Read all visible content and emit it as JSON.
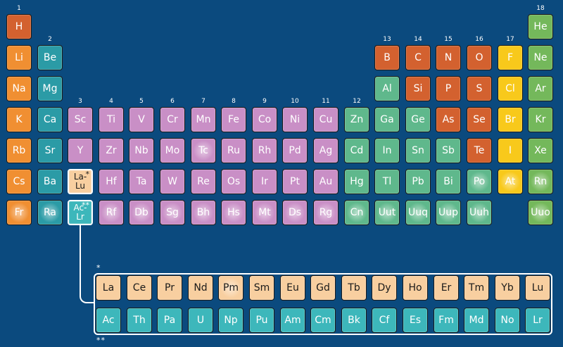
{
  "group_labels": [
    "1",
    "2",
    "3",
    "4",
    "5",
    "6",
    "7",
    "8",
    "9",
    "10",
    "11",
    "12",
    "13",
    "14",
    "15",
    "16",
    "17",
    "18"
  ],
  "colors": {
    "background": "#0b4a7e",
    "reactive_nonmetal": "#d3612f",
    "alkali_metal": "#f08f32",
    "alkaline_earth": "#2b9ba6",
    "transition_metal": "#c98fc6",
    "post_transition": "#5fb88c",
    "metalloid": "#5fb88c",
    "halogen": "#f8c91b",
    "noble_gas": "#74b85b",
    "lanthanide": "#f8cfa0",
    "actinide": "#3db7bb"
  },
  "elements": [
    {
      "sym": "H",
      "row": 1,
      "col": 1,
      "cat": "reactive_nonmetal"
    },
    {
      "sym": "He",
      "row": 1,
      "col": 18,
      "cat": "noble_gas"
    },
    {
      "sym": "Li",
      "row": 2,
      "col": 1,
      "cat": "alkali_metal"
    },
    {
      "sym": "Be",
      "row": 2,
      "col": 2,
      "cat": "alkaline_earth"
    },
    {
      "sym": "B",
      "row": 2,
      "col": 13,
      "cat": "reactive_nonmetal"
    },
    {
      "sym": "C",
      "row": 2,
      "col": 14,
      "cat": "reactive_nonmetal"
    },
    {
      "sym": "N",
      "row": 2,
      "col": 15,
      "cat": "reactive_nonmetal"
    },
    {
      "sym": "O",
      "row": 2,
      "col": 16,
      "cat": "reactive_nonmetal"
    },
    {
      "sym": "F",
      "row": 2,
      "col": 17,
      "cat": "halogen"
    },
    {
      "sym": "Ne",
      "row": 2,
      "col": 18,
      "cat": "noble_gas"
    },
    {
      "sym": "Na",
      "row": 3,
      "col": 1,
      "cat": "alkali_metal"
    },
    {
      "sym": "Mg",
      "row": 3,
      "col": 2,
      "cat": "alkaline_earth"
    },
    {
      "sym": "Al",
      "row": 3,
      "col": 13,
      "cat": "post_transition"
    },
    {
      "sym": "Si",
      "row": 3,
      "col": 14,
      "cat": "reactive_nonmetal"
    },
    {
      "sym": "P",
      "row": 3,
      "col": 15,
      "cat": "reactive_nonmetal"
    },
    {
      "sym": "S",
      "row": 3,
      "col": 16,
      "cat": "reactive_nonmetal"
    },
    {
      "sym": "Cl",
      "row": 3,
      "col": 17,
      "cat": "halogen"
    },
    {
      "sym": "Ar",
      "row": 3,
      "col": 18,
      "cat": "noble_gas"
    },
    {
      "sym": "K",
      "row": 4,
      "col": 1,
      "cat": "alkali_metal"
    },
    {
      "sym": "Ca",
      "row": 4,
      "col": 2,
      "cat": "alkaline_earth"
    },
    {
      "sym": "Sc",
      "row": 4,
      "col": 3,
      "cat": "transition_metal"
    },
    {
      "sym": "Ti",
      "row": 4,
      "col": 4,
      "cat": "transition_metal"
    },
    {
      "sym": "V",
      "row": 4,
      "col": 5,
      "cat": "transition_metal"
    },
    {
      "sym": "Cr",
      "row": 4,
      "col": 6,
      "cat": "transition_metal"
    },
    {
      "sym": "Mn",
      "row": 4,
      "col": 7,
      "cat": "transition_metal"
    },
    {
      "sym": "Fe",
      "row": 4,
      "col": 8,
      "cat": "transition_metal"
    },
    {
      "sym": "Co",
      "row": 4,
      "col": 9,
      "cat": "transition_metal"
    },
    {
      "sym": "Ni",
      "row": 4,
      "col": 10,
      "cat": "transition_metal"
    },
    {
      "sym": "Cu",
      "row": 4,
      "col": 11,
      "cat": "transition_metal"
    },
    {
      "sym": "Zn",
      "row": 4,
      "col": 12,
      "cat": "post_transition"
    },
    {
      "sym": "Ga",
      "row": 4,
      "col": 13,
      "cat": "post_transition"
    },
    {
      "sym": "Ge",
      "row": 4,
      "col": 14,
      "cat": "post_transition"
    },
    {
      "sym": "As",
      "row": 4,
      "col": 15,
      "cat": "reactive_nonmetal"
    },
    {
      "sym": "Se",
      "row": 4,
      "col": 16,
      "cat": "reactive_nonmetal"
    },
    {
      "sym": "Br",
      "row": 4,
      "col": 17,
      "cat": "halogen"
    },
    {
      "sym": "Kr",
      "row": 4,
      "col": 18,
      "cat": "noble_gas"
    },
    {
      "sym": "Rb",
      "row": 5,
      "col": 1,
      "cat": "alkali_metal"
    },
    {
      "sym": "Sr",
      "row": 5,
      "col": 2,
      "cat": "alkaline_earth"
    },
    {
      "sym": "Y",
      "row": 5,
      "col": 3,
      "cat": "transition_metal"
    },
    {
      "sym": "Zr",
      "row": 5,
      "col": 4,
      "cat": "transition_metal"
    },
    {
      "sym": "Nb",
      "row": 5,
      "col": 5,
      "cat": "transition_metal"
    },
    {
      "sym": "Mo",
      "row": 5,
      "col": 6,
      "cat": "transition_metal"
    },
    {
      "sym": "Tc",
      "row": 5,
      "col": 7,
      "cat": "transition_metal",
      "glow": true
    },
    {
      "sym": "Ru",
      "row": 5,
      "col": 8,
      "cat": "transition_metal"
    },
    {
      "sym": "Rh",
      "row": 5,
      "col": 9,
      "cat": "transition_metal"
    },
    {
      "sym": "Pd",
      "row": 5,
      "col": 10,
      "cat": "transition_metal"
    },
    {
      "sym": "Ag",
      "row": 5,
      "col": 11,
      "cat": "transition_metal"
    },
    {
      "sym": "Cd",
      "row": 5,
      "col": 12,
      "cat": "post_transition"
    },
    {
      "sym": "In",
      "row": 5,
      "col": 13,
      "cat": "post_transition"
    },
    {
      "sym": "Sn",
      "row": 5,
      "col": 14,
      "cat": "post_transition"
    },
    {
      "sym": "Sb",
      "row": 5,
      "col": 15,
      "cat": "post_transition"
    },
    {
      "sym": "Te",
      "row": 5,
      "col": 16,
      "cat": "reactive_nonmetal"
    },
    {
      "sym": "I",
      "row": 5,
      "col": 17,
      "cat": "halogen"
    },
    {
      "sym": "Xe",
      "row": 5,
      "col": 18,
      "cat": "noble_gas"
    },
    {
      "sym": "Cs",
      "row": 6,
      "col": 1,
      "cat": "alkali_metal"
    },
    {
      "sym": "Ba",
      "row": 6,
      "col": 2,
      "cat": "alkaline_earth"
    },
    {
      "sym": "La-",
      "sym2": "Lu",
      "mark": "*",
      "row": 6,
      "col": 3,
      "cat": "lanthanide",
      "dark": true,
      "stack": true,
      "outlined": true
    },
    {
      "sym": "Hf",
      "row": 6,
      "col": 4,
      "cat": "transition_metal"
    },
    {
      "sym": "Ta",
      "row": 6,
      "col": 5,
      "cat": "transition_metal"
    },
    {
      "sym": "W",
      "row": 6,
      "col": 6,
      "cat": "transition_metal"
    },
    {
      "sym": "Re",
      "row": 6,
      "col": 7,
      "cat": "transition_metal"
    },
    {
      "sym": "Os",
      "row": 6,
      "col": 8,
      "cat": "transition_metal"
    },
    {
      "sym": "Ir",
      "row": 6,
      "col": 9,
      "cat": "transition_metal"
    },
    {
      "sym": "Pt",
      "row": 6,
      "col": 10,
      "cat": "transition_metal"
    },
    {
      "sym": "Au",
      "row": 6,
      "col": 11,
      "cat": "transition_metal"
    },
    {
      "sym": "Hg",
      "row": 6,
      "col": 12,
      "cat": "post_transition"
    },
    {
      "sym": "Tl",
      "row": 6,
      "col": 13,
      "cat": "post_transition"
    },
    {
      "sym": "Pb",
      "row": 6,
      "col": 14,
      "cat": "post_transition"
    },
    {
      "sym": "Bi",
      "row": 6,
      "col": 15,
      "cat": "post_transition"
    },
    {
      "sym": "Po",
      "row": 6,
      "col": 16,
      "cat": "post_transition",
      "glow": true
    },
    {
      "sym": "At",
      "row": 6,
      "col": 17,
      "cat": "halogen",
      "glow": true
    },
    {
      "sym": "Rn",
      "row": 6,
      "col": 18,
      "cat": "noble_gas",
      "glow": true
    },
    {
      "sym": "Fr",
      "row": 7,
      "col": 1,
      "cat": "alkali_metal",
      "glow": true
    },
    {
      "sym": "Ra",
      "row": 7,
      "col": 2,
      "cat": "alkaline_earth",
      "glow": true
    },
    {
      "sym": "Ac-",
      "sym2": "Lr",
      "mark": "**",
      "row": 7,
      "col": 3,
      "cat": "actinide",
      "stack": true,
      "outlined": true
    },
    {
      "sym": "Rf",
      "row": 7,
      "col": 4,
      "cat": "transition_metal",
      "glow": true
    },
    {
      "sym": "Db",
      "row": 7,
      "col": 5,
      "cat": "transition_metal",
      "glow": true
    },
    {
      "sym": "Sg",
      "row": 7,
      "col": 6,
      "cat": "transition_metal",
      "glow": true
    },
    {
      "sym": "Bh",
      "row": 7,
      "col": 7,
      "cat": "transition_metal",
      "glow": true
    },
    {
      "sym": "Hs",
      "row": 7,
      "col": 8,
      "cat": "transition_metal",
      "glow": true
    },
    {
      "sym": "Mt",
      "row": 7,
      "col": 9,
      "cat": "transition_metal",
      "glow": true
    },
    {
      "sym": "Ds",
      "row": 7,
      "col": 10,
      "cat": "transition_metal",
      "glow": true
    },
    {
      "sym": "Rg",
      "row": 7,
      "col": 11,
      "cat": "transition_metal",
      "glow": true
    },
    {
      "sym": "Cn",
      "row": 7,
      "col": 12,
      "cat": "post_transition",
      "glow": true
    },
    {
      "sym": "Uut",
      "row": 7,
      "col": 13,
      "cat": "post_transition",
      "glow": true
    },
    {
      "sym": "Uuq",
      "row": 7,
      "col": 14,
      "cat": "post_transition",
      "glow": true
    },
    {
      "sym": "Uup",
      "row": 7,
      "col": 15,
      "cat": "post_transition",
      "glow": true
    },
    {
      "sym": "Uuh",
      "row": 7,
      "col": 16,
      "cat": "post_transition",
      "glow": true
    },
    {
      "sym": "Uuo",
      "row": 7,
      "col": 18,
      "cat": "noble_gas",
      "glow": true
    }
  ],
  "lanthanides": {
    "mark": "*",
    "items": [
      "La",
      "Ce",
      "Pr",
      "Nd",
      "Pm",
      "Sm",
      "Eu",
      "Gd",
      "Tb",
      "Dy",
      "Ho",
      "Er",
      "Tm",
      "Yb",
      "Lu"
    ],
    "glow_index": 4
  },
  "actinides": {
    "mark": "**",
    "items": [
      "Ac",
      "Th",
      "Pa",
      "U",
      "Np",
      "Pu",
      "Am",
      "Cm",
      "Bk",
      "Cf",
      "Es",
      "Fm",
      "Md",
      "No",
      "Lr"
    ]
  }
}
